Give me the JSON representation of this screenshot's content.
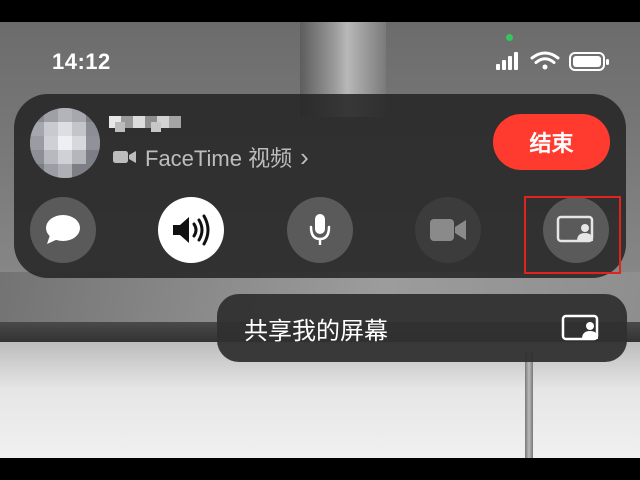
{
  "status_bar": {
    "time": "14:12"
  },
  "call": {
    "subtitle": "FaceTime 视频",
    "chevron": "›",
    "end_label": "结束"
  },
  "controls": [
    {
      "name": "message",
      "icon": "message-bubble-icon"
    },
    {
      "name": "speaker",
      "icon": "speaker-wave-icon",
      "active": true
    },
    {
      "name": "mic",
      "icon": "microphone-icon"
    },
    {
      "name": "camera",
      "icon": "video-camera-icon",
      "disabled": true
    },
    {
      "name": "share",
      "icon": "share-screen-icon"
    }
  ],
  "share_menu": {
    "label": "共享我的屏幕",
    "icon": "share-screen-icon"
  },
  "colors": {
    "end_button": "#ff3b30",
    "camera_indicator": "#34c759",
    "highlight": "#e0231f"
  }
}
